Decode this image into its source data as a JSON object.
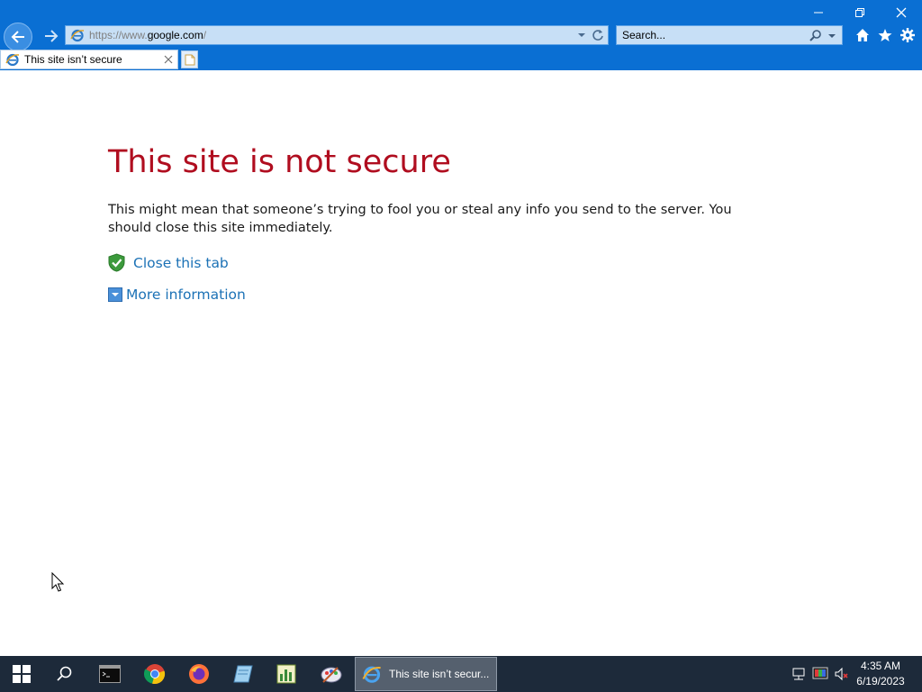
{
  "browser": {
    "address": {
      "scheme_prefix": "https://www.",
      "host": "google.com",
      "path": "/"
    },
    "search_placeholder": "Search...",
    "tab": {
      "title": "This site isn’t secure"
    }
  },
  "page": {
    "title": "This site is not secure",
    "description": "This might mean that someone’s trying to fool you or steal any info you send to the server. You should close this site immediately.",
    "close_tab_label": "Close this tab",
    "more_info_label": "More information"
  },
  "taskbar": {
    "active_task_label": "This site isn’t secur...",
    "time": "4:35 AM",
    "date": "6/19/2023"
  },
  "colors": {
    "titlebar": "#0a6fd3",
    "error_title": "#b00d1f",
    "link": "#1c72b6",
    "taskbar": "#1d2a3a"
  }
}
